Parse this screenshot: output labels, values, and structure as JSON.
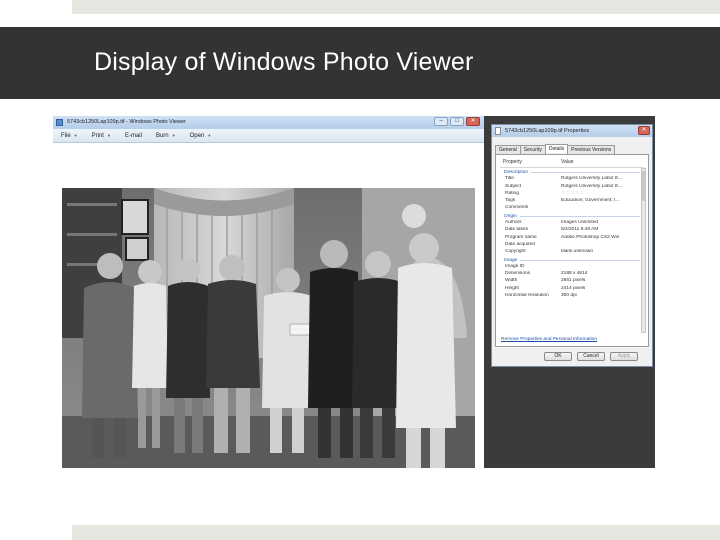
{
  "slide": {
    "title": "Display of Windows Photo Viewer"
  },
  "viewer": {
    "window_title": "5743cb1250Lap109p.tif - Windows Photo Viewer",
    "menu": [
      {
        "label": "File"
      },
      {
        "label": "Print"
      },
      {
        "label": "E-mail"
      },
      {
        "label": "Burn"
      },
      {
        "label": "Open"
      }
    ],
    "photo_alt": "Black and white photograph of a group of men in suits shaking hands, passing a check"
  },
  "properties": {
    "title": "5743cb1250Lap109p.tif Properties",
    "tabs": [
      "General",
      "Security",
      "Details",
      "Previous Versions"
    ],
    "active_tab": "Details",
    "columns": {
      "property": "Property",
      "value": "Value"
    },
    "sections": [
      {
        "name": "Description",
        "rows": [
          {
            "key": "Title",
            "value": "Rutgers University Labor E..."
          },
          {
            "key": "Subject",
            "value": "Rutgers University Labor E..."
          },
          {
            "key": "Rating",
            "value": "☆☆☆☆☆"
          },
          {
            "key": "Tags",
            "value": "Education; Government; I..."
          },
          {
            "key": "Comments",
            "value": ""
          }
        ]
      },
      {
        "name": "Origin",
        "rows": [
          {
            "key": "Authors",
            "value": "Images Unlimited"
          },
          {
            "key": "Date taken",
            "value": "6/2/2011 9:48 AM"
          },
          {
            "key": "Program name",
            "value": "Adobe Photoshop CS2 Win"
          },
          {
            "key": "Date acquired",
            "value": ""
          },
          {
            "key": "Copyright",
            "value": "blank unknown"
          }
        ]
      },
      {
        "name": "Image",
        "rows": [
          {
            "key": "Image ID",
            "value": ""
          },
          {
            "key": "Dimensions",
            "value": "2188 x 4614"
          },
          {
            "key": "Width",
            "value": "2881 pixels"
          },
          {
            "key": "Height",
            "value": "2414 pixels"
          },
          {
            "key": "Horizontal resolution",
            "value": "300 dpi"
          }
        ]
      }
    ],
    "remove_link": "Remove Properties and Personal Information",
    "buttons": {
      "ok": "OK",
      "cancel": "Cancel",
      "apply": "Apply"
    }
  },
  "colors": {
    "title_bar": "#333333",
    "strip": "#e6e6e1",
    "window_chrome": "#b4cde9"
  }
}
